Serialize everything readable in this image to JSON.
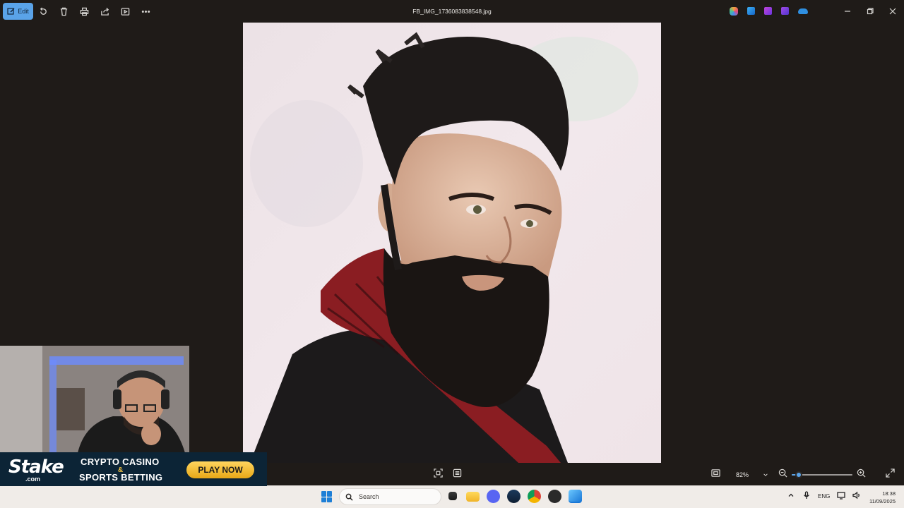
{
  "titlebar": {
    "edit_label": "Edit",
    "file_name": "FB_IMG_1736083838548.jpg",
    "app_icons": [
      "copilot-icon",
      "photos-icon",
      "clipchamp-icon",
      "designer-icon",
      "onedrive-icon"
    ]
  },
  "bottombar": {
    "zoom_value": "82%",
    "zoom_slider_fraction": 0.12
  },
  "taskbar": {
    "search_placeholder": "Search",
    "language": "ENG",
    "time": "18:38",
    "date": "11/09/2025",
    "apps": [
      "file-explorer-icon",
      "folder-icon",
      "discord-icon",
      "steam-icon",
      "chrome-icon",
      "media-app-icon",
      "photos-taskbar-icon"
    ]
  },
  "overlay": {
    "brand": "Stake",
    "brand_sub": ".com",
    "line1": "CRYPTO CASINO",
    "amp": "&",
    "line2": "SPORTS BETTING",
    "cta": "PLAY NOW"
  },
  "colors": {
    "accent": "#5aa3e8",
    "app_bg": "#1f1b18",
    "taskbar_bg": "#f0ece8",
    "banner_bg": "#0c2436",
    "cta_gold": "#f5c542"
  }
}
